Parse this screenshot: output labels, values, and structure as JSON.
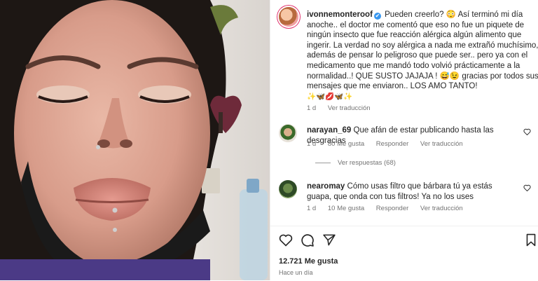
{
  "post": {
    "username": "ivonnemonteroof",
    "verified_mark": "✔",
    "caption": "Pueden creerlo? 😳 Así terminó mi día anoche.. el doctor me comentó que eso no fue un piquete de ningún insecto que fue reacción alérgica algún alimento que ingerir. La verdad no soy alérgica a nada me extrañó muchísimo, además de pensar lo peligroso que puede ser.. pero ya con el medicamento que me mandó todo volvió prácticamente a la normalidad..! QUE SUSTO JAJAJA ! 😅😉 gracias por todos sus mensajes que me enviaron.. LOS AMO TANTO!",
    "emoji_line": "✨🦋💋🦋✨",
    "age": "1 d",
    "translate": "Ver traducción"
  },
  "comments": [
    {
      "username": "narayan_69",
      "text": "Que afán de estar publicando hasta las desgracias",
      "age": "1 d",
      "likes": "80 Me gusta",
      "reply": "Responder",
      "translate": "Ver traducción",
      "replies": "Ver respuestas (68)"
    },
    {
      "username": "nearomay",
      "text": "Cómo usas filtro que bárbara tú ya estás guapa, que onda con tus filtros! Ya no los uses",
      "age": "1 d",
      "likes": "10 Me gusta",
      "reply": "Responder",
      "translate": "Ver traducción"
    }
  ],
  "footer": {
    "likes": "12.721 Me gusta",
    "time": "Hace un día"
  },
  "icons": [
    "heart-icon",
    "comment-icon",
    "share-icon",
    "bookmark-icon"
  ],
  "colors": {
    "verified": "#3897f0",
    "muted": "#737373",
    "text": "#262626"
  }
}
